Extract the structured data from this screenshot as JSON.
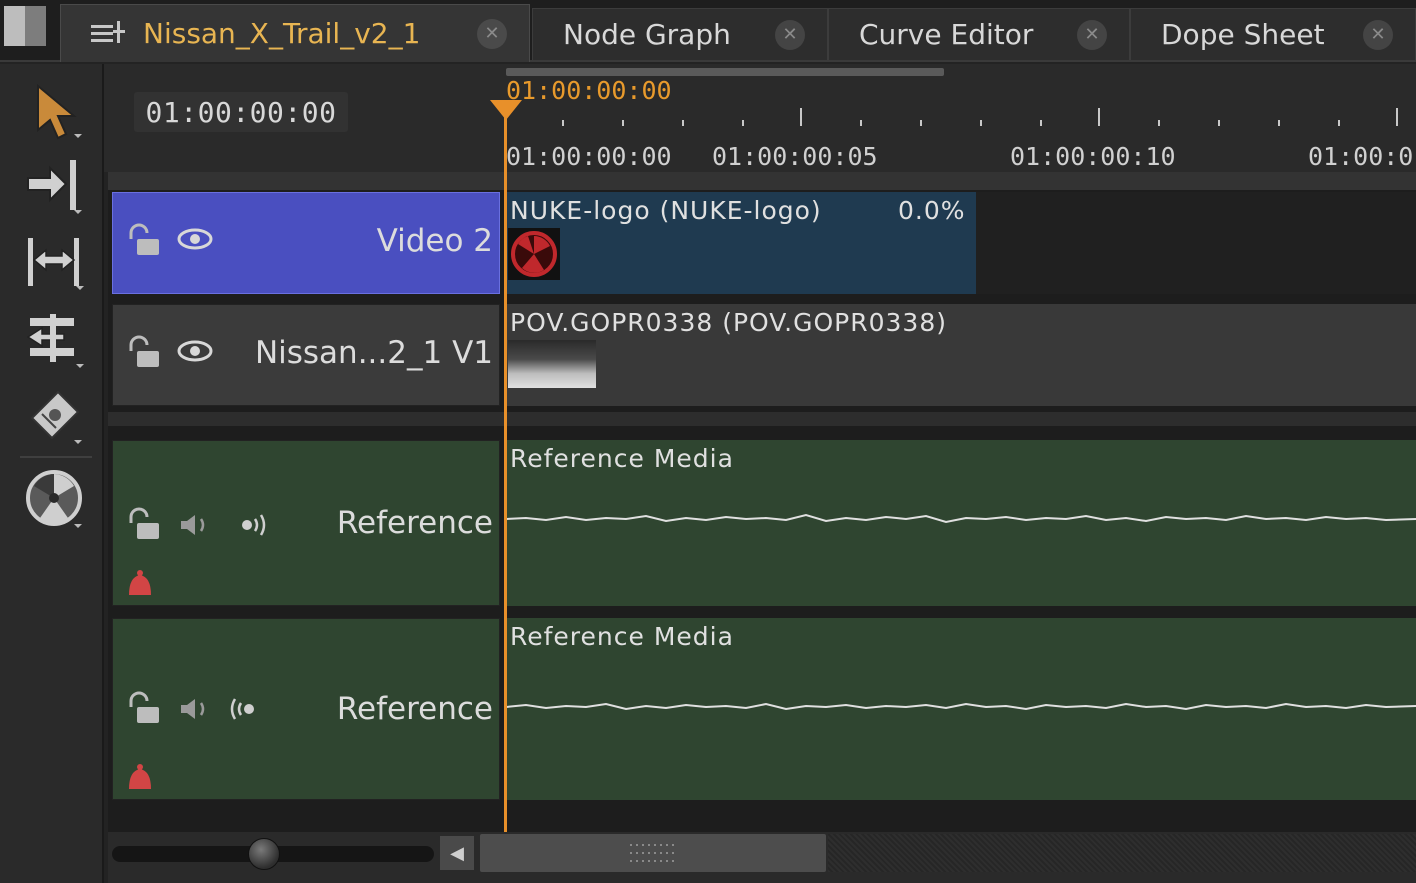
{
  "tabs": [
    {
      "label": "Nissan_X_Trail_v2_1",
      "active": true,
      "icon": "sequence-icon"
    },
    {
      "label": "Node Graph",
      "active": false
    },
    {
      "label": "Curve Editor",
      "active": false
    },
    {
      "label": "Dope Sheet",
      "active": false
    }
  ],
  "tools": [
    "pointer-tool",
    "track-select-tool",
    "slip-tool",
    "ripple-tool",
    "razor-tool",
    "nuke-logo-tool"
  ],
  "timeline": {
    "current_timecode": "01:00:00:00",
    "ruler_current": "01:00:00:00",
    "ruler_labels": [
      "01:00:00:00",
      "01:00:00:05",
      "01:00:00:10",
      "01:00:0"
    ]
  },
  "tracks": [
    {
      "name": "Video 2",
      "type": "video",
      "selected": true,
      "clip_label": "NUKE-logo (NUKE-logo)",
      "clip_percent": "0.0%"
    },
    {
      "name": "Nissan...2_1 V1",
      "type": "video",
      "selected": false,
      "clip_label": "POV.GOPR0338 (POV.GOPR0338)"
    },
    {
      "name": "Reference",
      "type": "audio",
      "clip_label": "Reference Media"
    },
    {
      "name": "Reference",
      "type": "audio",
      "clip_label": "Reference Media"
    }
  ],
  "colors": {
    "accent": "#e8902a",
    "video2_header": "#4a4fc0",
    "video2_clip": "#1f3a50",
    "audio_lane": "#2f4530"
  }
}
